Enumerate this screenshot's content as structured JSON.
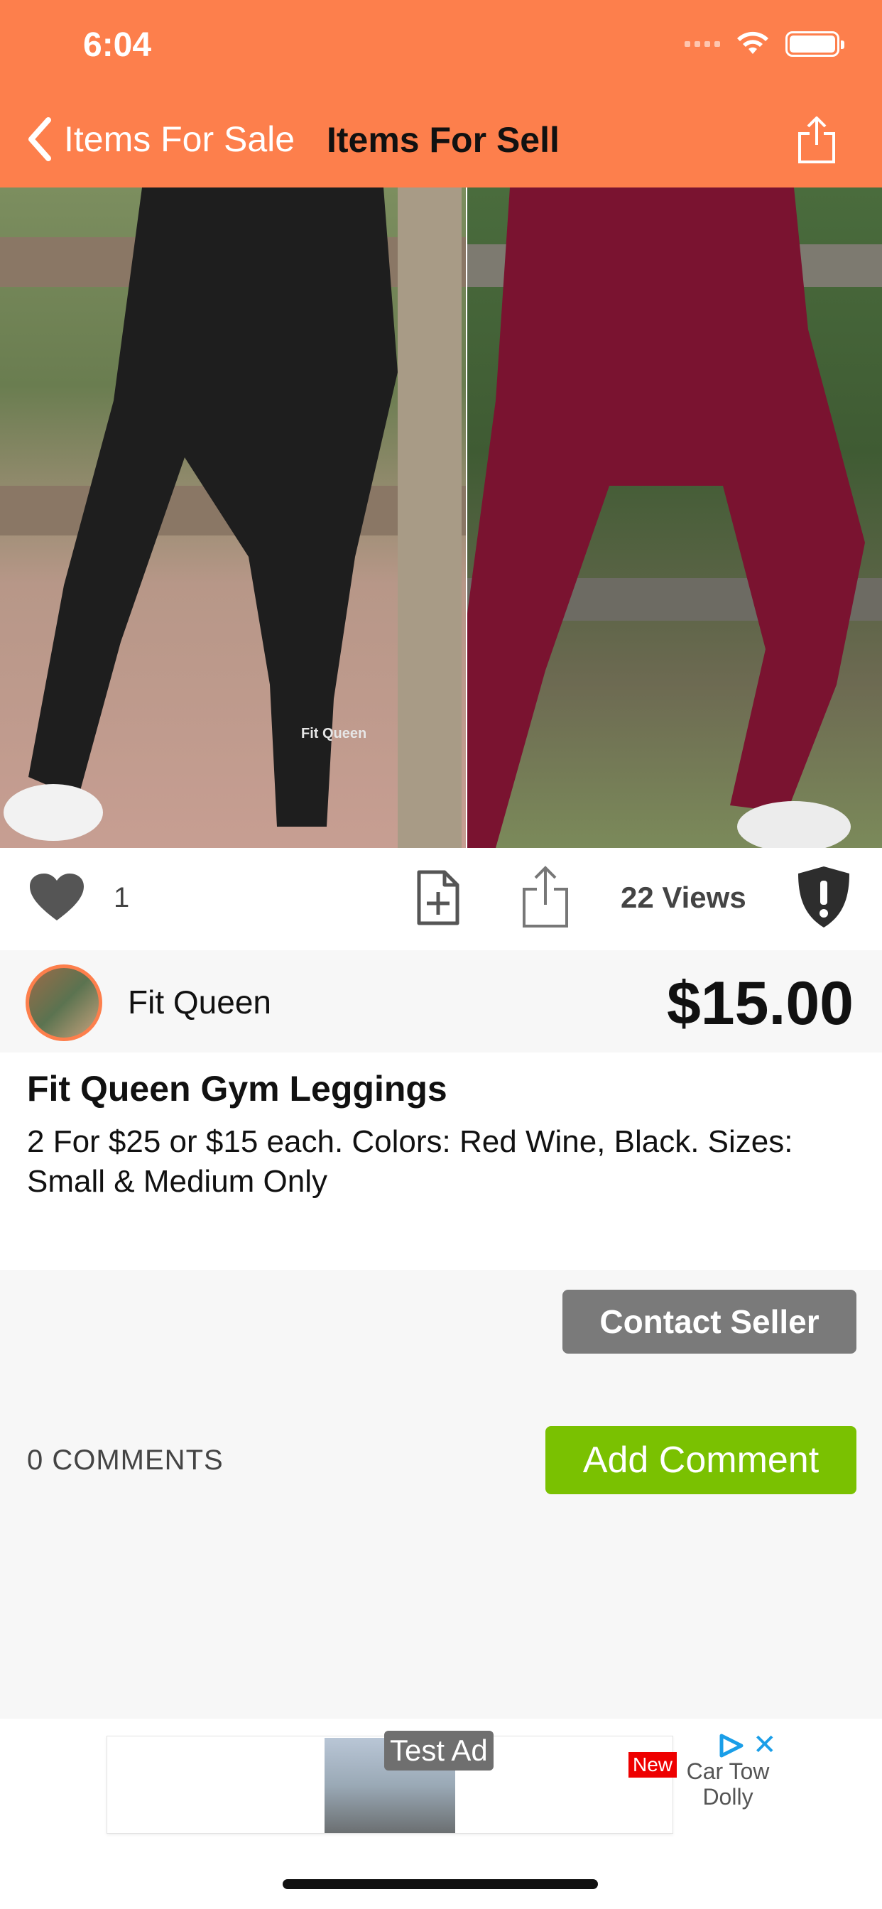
{
  "status_bar": {
    "time": "6:04"
  },
  "nav": {
    "back_label": "Items For Sale",
    "title": "Items For Sell"
  },
  "listing": {
    "likes": "1",
    "views": "22 Views",
    "seller_name": "Fit Queen",
    "price": "$15.00",
    "title": "Fit Queen Gym Leggings",
    "description": "2 For $25 or $15 each. Colors: Red Wine, Black. Sizes: Small & Medium Only",
    "photo_brand_text": "Fit Queen"
  },
  "actions": {
    "contact_label": "Contact Seller",
    "comments_label": "0 COMMENTS",
    "add_comment_label": "Add Comment"
  },
  "ad": {
    "label": "Test Ad",
    "badge": "New",
    "text": "Car Tow Dolly"
  },
  "colors": {
    "header": "#fd7f4c",
    "contact_button": "#7a7a7a",
    "add_comment_button": "#7ac101"
  }
}
